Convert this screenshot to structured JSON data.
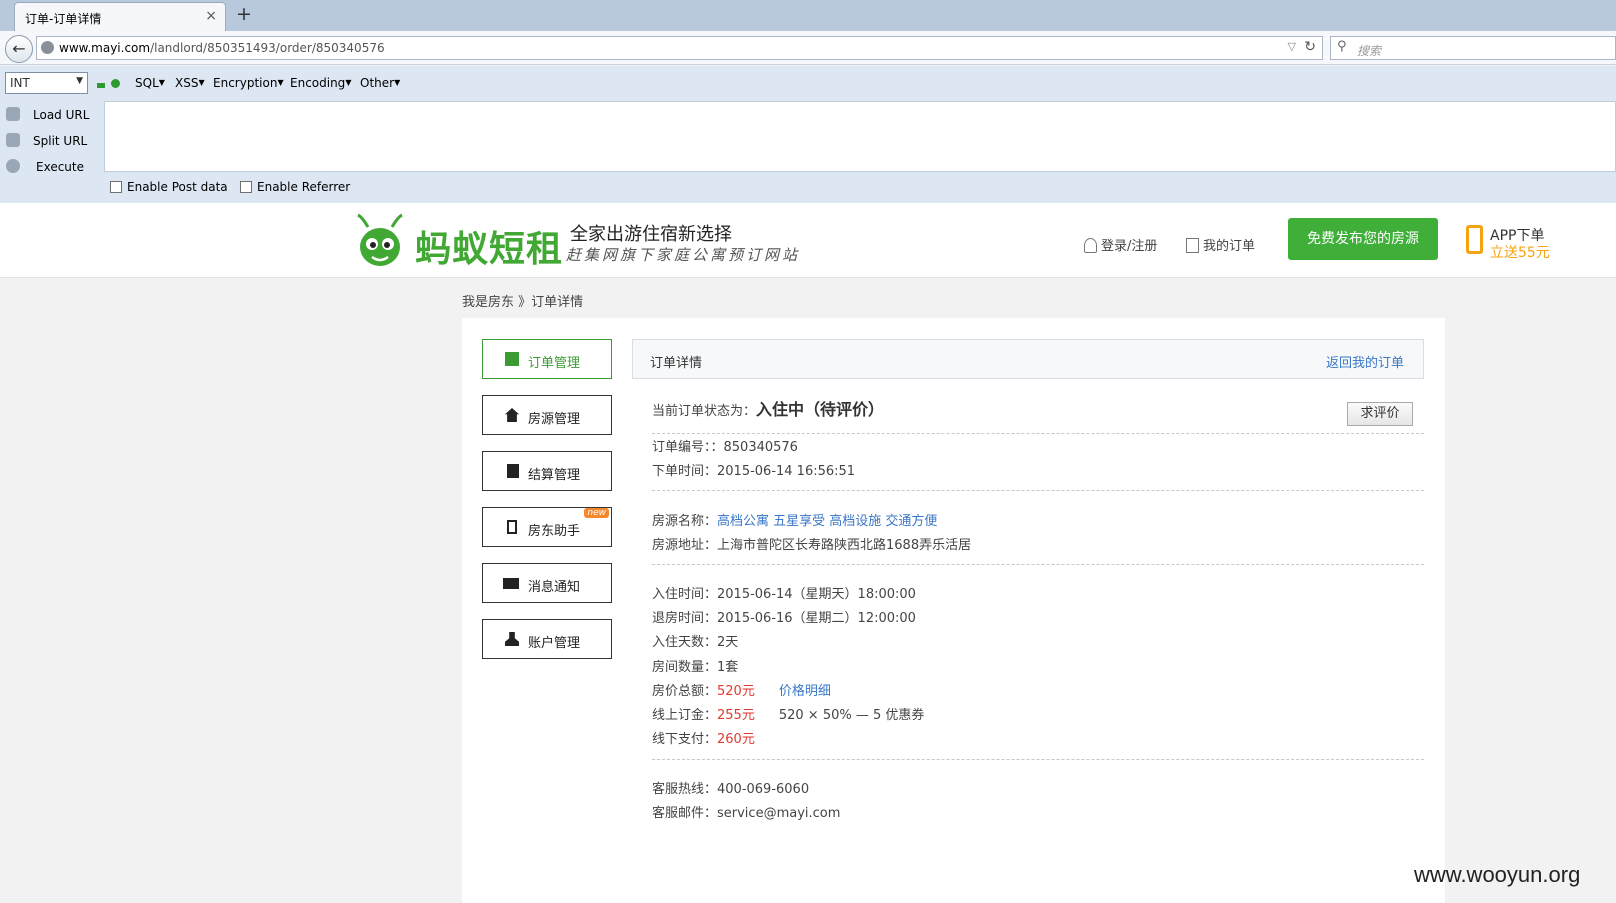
{
  "browser": {
    "tab_title": "订单-订单详情",
    "tab_close": "×",
    "tab_new": "+",
    "url_host": "www.mayi.com",
    "url_path": "/landlord/850351493/order/850340576",
    "search_placeholder": "搜索"
  },
  "hackbar": {
    "select_value": "INT",
    "menus": [
      "SQL",
      "XSS",
      "Encryption",
      "Encoding",
      "Other"
    ],
    "actions": [
      "Load URL",
      "Split URL",
      "Execute"
    ],
    "checkboxes": [
      "Enable Post data",
      "Enable Referrer"
    ]
  },
  "header": {
    "brand": "蚂蚁短租",
    "slogan": "全家出游住宿新选择",
    "slogan_sub": "赶集网旗下家庭公寓预订网站",
    "login": "登录/注册",
    "my_orders": "我的订单",
    "publish": "免费发布您的房源",
    "app_title": "APP下单",
    "app_sub": "立送55元",
    "brand_color": "#40a833",
    "accent_orange": "#f5a312"
  },
  "breadcrumb": "我是房东 》订单详情",
  "sidebar": {
    "items": [
      {
        "label": "订单管理",
        "icon": "orders-icon",
        "active": true
      },
      {
        "label": "房源管理",
        "icon": "house-icon"
      },
      {
        "label": "结算管理",
        "icon": "clipboard-icon"
      },
      {
        "label": "房东助手",
        "icon": "phone-icon",
        "badge": "new"
      },
      {
        "label": "消息通知",
        "icon": "mail-icon"
      },
      {
        "label": "账户管理",
        "icon": "user-icon"
      }
    ]
  },
  "detail": {
    "title": "订单详情",
    "back_link": "返回我的订单",
    "status_label": "当前订单状态为：",
    "status_value": "入住中（待评价）",
    "review_button": "求评价",
    "order_no": "订单编号：：850340576",
    "order_time": "下单时间：2015-06-14 16:56:51",
    "house_name_label": "房源名称：",
    "house_name": "高档公寓 五星享受 高档设施 交通方便",
    "house_address": "房源地址：上海市普陀区长寿路陕西北路1688弄乐活居",
    "checkin": "入住时间：2015-06-14（星期天）18:00:00",
    "checkout": "退房时间：2015-06-16（星期二）12:00:00",
    "days": "入住天数：2天",
    "rooms": "房间数量：1套",
    "total_label": "房价总额：",
    "total_value": "520元",
    "price_detail": "价格明细",
    "deposit_label": "线上订金：",
    "deposit_value": "255元",
    "deposit_note": "520 × 50% — 5 优惠券",
    "offline_label": "线下支付：",
    "offline_value": "260元",
    "hotline": "客服热线：400-069-6060",
    "email": "客服邮件：service@mayi.com"
  },
  "watermark": "www.wooyun.org"
}
